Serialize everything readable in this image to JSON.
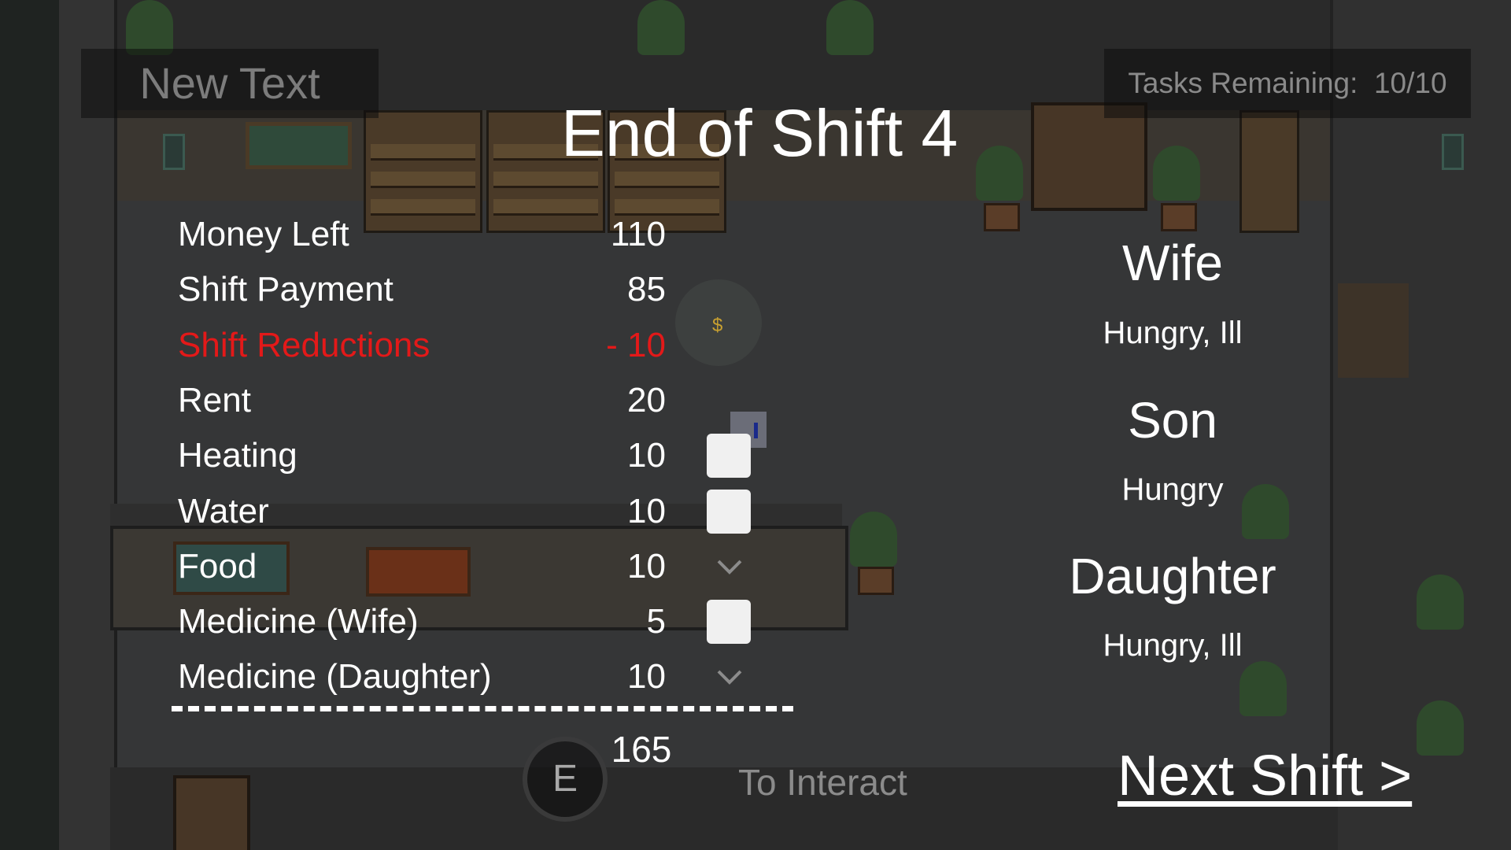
{
  "hud": {
    "new_text": "New Text",
    "tasks_remaining": "Tasks Remaining:  10/10",
    "interact_key": "E",
    "interact_label": "To Interact"
  },
  "summary": {
    "title": "End of Shift 4",
    "rows": [
      {
        "label": "Money Left",
        "value": "110",
        "control": "none"
      },
      {
        "label": "Shift Payment",
        "value": "85",
        "control": "none"
      },
      {
        "label": "Shift Reductions",
        "value": "- 10",
        "control": "none",
        "color": "#e31919"
      },
      {
        "label": "Rent",
        "value": "20",
        "control": "none"
      },
      {
        "label": "Heating",
        "value": "10",
        "control": "checkbox",
        "checked": false
      },
      {
        "label": "Water",
        "value": "10",
        "control": "checkbox",
        "checked": false
      },
      {
        "label": "Food",
        "value": "10",
        "control": "checkmark",
        "checked": true
      },
      {
        "label": "Medicine (Wife)",
        "value": "5",
        "control": "checkbox",
        "checked": false
      },
      {
        "label": "Medicine (Daughter)",
        "value": "10",
        "control": "checkmark",
        "checked": true
      }
    ],
    "total": "165"
  },
  "family": [
    {
      "name": "Wife",
      "status": "Hungry, Ill"
    },
    {
      "name": "Son",
      "status": "Hungry"
    },
    {
      "name": "Daughter",
      "status": "Hungry, Ill"
    }
  ],
  "next_shift_label": "Next Shift >",
  "colors": {
    "text": "#ffffff",
    "reduction": "#e31919",
    "checkbox": "#f0f0f0",
    "overlay_panel": "#0c0c0c"
  }
}
